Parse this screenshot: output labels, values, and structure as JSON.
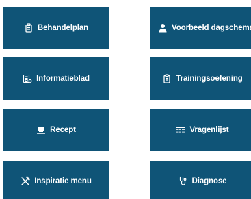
{
  "tiles": [
    {
      "label": "Behandelplan",
      "icon": "clipboard-icon"
    },
    {
      "label": "Voorbeeld dagschema",
      "icon": "person-icon"
    },
    {
      "label": "Informatieblad",
      "icon": "info-sheet-icon"
    },
    {
      "label": "Trainingsoefening",
      "icon": "clipboard-icon"
    },
    {
      "label": "Recept",
      "icon": "cooking-pot-icon"
    },
    {
      "label": "Vragenlijst",
      "icon": "list-table-icon"
    },
    {
      "label": "Inspiratie menu",
      "icon": "cutlery-icon"
    },
    {
      "label": "Diagnose",
      "icon": "stethoscope-icon"
    }
  ],
  "colors": {
    "tile_background": "#0f5477",
    "tile_text": "#ffffff",
    "page_background": "#ffffff"
  }
}
